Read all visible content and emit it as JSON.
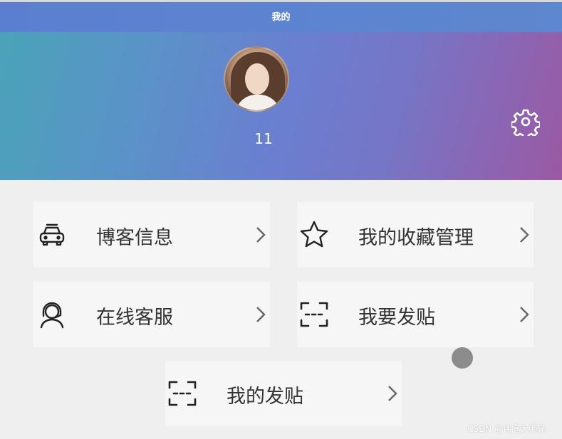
{
  "topbar": {
    "title": "我的"
  },
  "profile": {
    "username": "11",
    "avatar_icon": "user-avatar",
    "settings_icon": "gear-icon"
  },
  "menu": {
    "items": [
      {
        "label": "博客信息",
        "icon": "car-icon"
      },
      {
        "label": "我的收藏管理",
        "icon": "star-icon"
      },
      {
        "label": "在线客服",
        "icon": "headset-icon"
      },
      {
        "label": "我要发贴",
        "icon": "scan-icon"
      },
      {
        "label": "我的发贴",
        "icon": "scan-icon"
      }
    ]
  },
  "watermark": "CSDN @伟庭大师兄",
  "colors": {
    "header_start": "#4aa3b8",
    "header_mid": "#6a7fd0",
    "header_end": "#9b59a3",
    "background": "#efefef"
  }
}
